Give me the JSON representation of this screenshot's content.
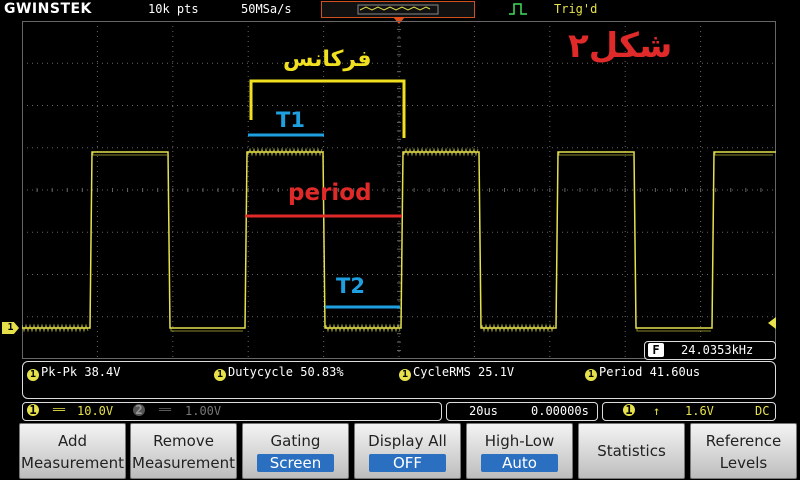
{
  "header": {
    "brand": "GWINSTEK",
    "memory_depth": "10k pts",
    "sample_rate": "50MSa/s",
    "trigger_state": "Trig'd"
  },
  "annotations": {
    "figure_label": "شکل۲",
    "frequency_label": "فرکانس",
    "t1_label": "T1",
    "t2_label": "T2",
    "period_label": "period"
  },
  "measurements": {
    "pkpk": "Pk-Pk 38.4V",
    "dutycycle": "Dutycycle 50.83%",
    "cyclerms": "CycleRMS 25.1V",
    "period": "Period 41.60us"
  },
  "freq_badge": {
    "letter": "F",
    "value": "24.0353kHz"
  },
  "channel_marker": "1",
  "status": {
    "ch1_num": "1",
    "ch1_coupling": "══",
    "ch1_scale": "10.0V",
    "ch2_num": "2",
    "ch2_coupling": "══",
    "ch2_scale": "1.00V",
    "timebase": "20us",
    "position": "0.00000s",
    "trig_ch": "1",
    "trig_slope": "↑",
    "trig_level": "1.6V",
    "trig_coupling": "DC"
  },
  "softkeys": [
    {
      "l1": "Add",
      "l2": "Measurement"
    },
    {
      "l1": "Remove",
      "l2": "Measurement"
    },
    {
      "l1": "Gating",
      "l2": "Screen"
    },
    {
      "l1": "Display All",
      "l2": "OFF"
    },
    {
      "l1": "High-Low",
      "l2": "Auto"
    },
    {
      "single": "Statistics"
    },
    {
      "l1": "Reference",
      "l2": "Levels"
    }
  ],
  "colors": {
    "trace": "#e6e14a",
    "annotation_blue": "#1ea0e0",
    "annotation_red": "#e02a2a",
    "annotation_yellow": "#f0e020",
    "grid": "#666666"
  }
}
